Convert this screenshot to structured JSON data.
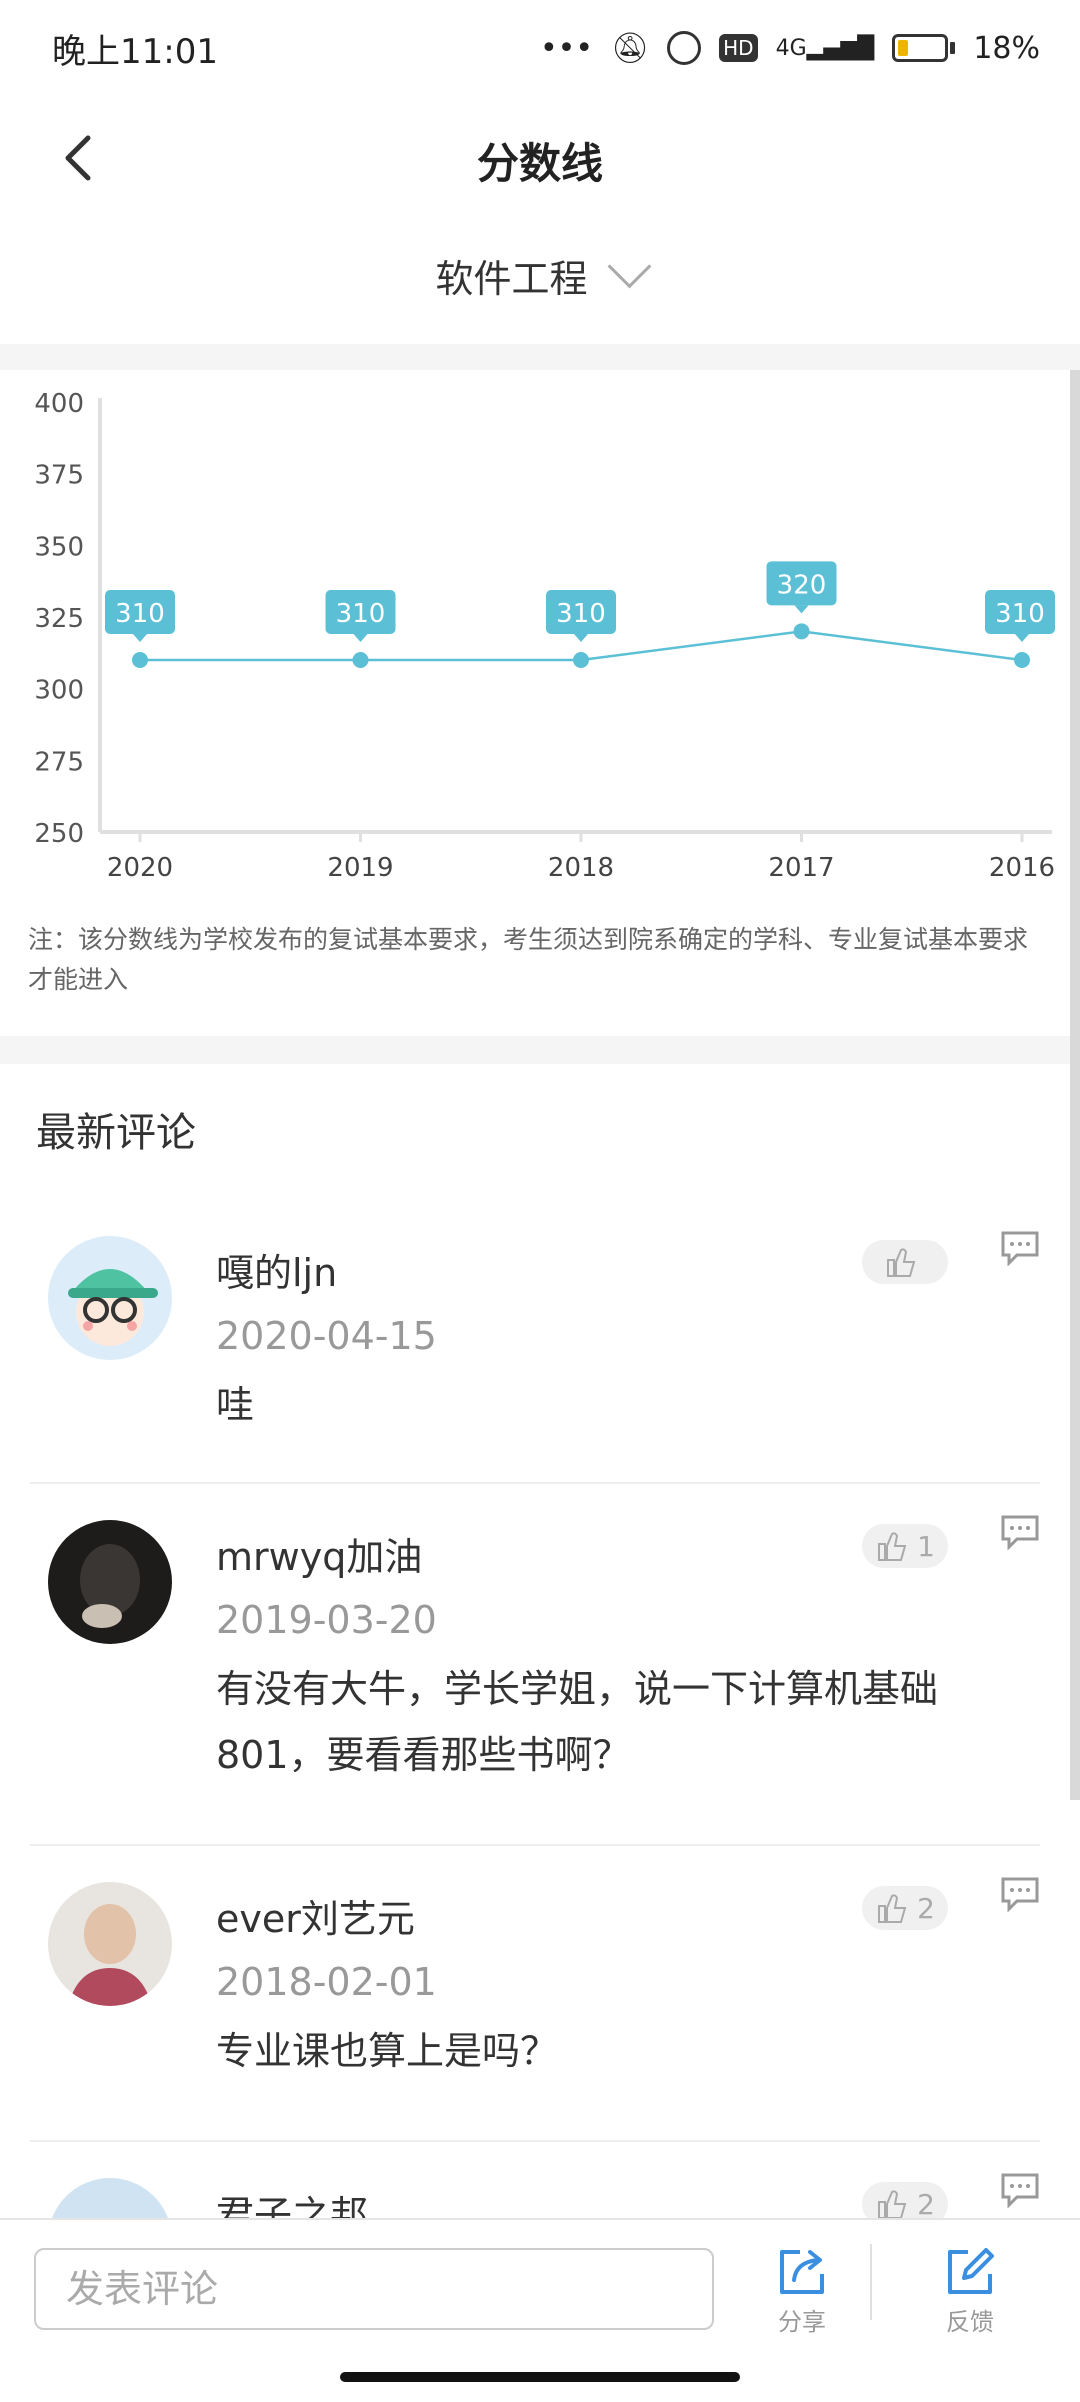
{
  "status": {
    "time": "晚上11:01",
    "battery": "18%",
    "network": "4G",
    "hd": "HD"
  },
  "header": {
    "title": "分数线"
  },
  "major_selector": {
    "value": "软件工程"
  },
  "chart_data": {
    "type": "line",
    "categories": [
      "2020",
      "2019",
      "2018",
      "2017",
      "2016"
    ],
    "values": [
      310,
      310,
      310,
      320,
      310
    ],
    "ylim": [
      250,
      400
    ],
    "yticks": [
      400,
      375,
      350,
      325,
      300,
      275,
      250
    ],
    "color": "#5bc0d6"
  },
  "note": "注：该分数线为学校发布的复试基本要求，考生须达到院系确定的学科、专业复试基本要求才能进入",
  "comments_section": {
    "title": "最新评论"
  },
  "comments": [
    {
      "name": "嘎的ljn",
      "date": "2020-04-15",
      "text": "哇",
      "likes": ""
    },
    {
      "name": "mrwyq加油",
      "date": "2019-03-20",
      "text": "有没有大牛，学长学姐，说一下计算机基础801，要看看那些书啊？",
      "likes": "1"
    },
    {
      "name": "ever刘艺元",
      "date": "2018-02-01",
      "text": "专业课也算上是吗？",
      "likes": "2"
    },
    {
      "name": "君子之邦",
      "date": "",
      "text": "",
      "likes": "2"
    }
  ],
  "bottom": {
    "input_placeholder": "发表评论",
    "share": "分享",
    "feedback": "反馈"
  }
}
